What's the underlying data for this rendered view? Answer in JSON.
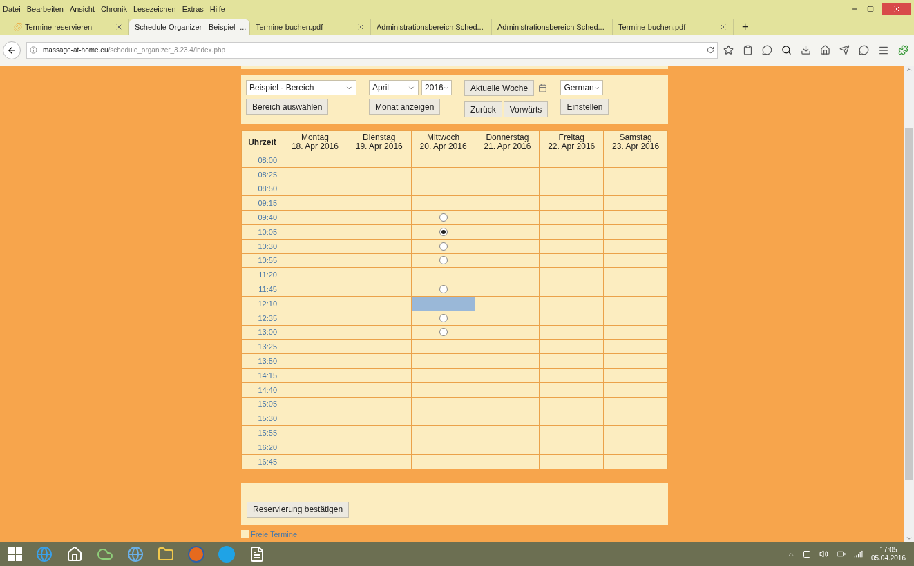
{
  "menu": [
    "Datei",
    "Bearbeiten",
    "Ansicht",
    "Chronik",
    "Lesezeichen",
    "Extras",
    "Hilfe"
  ],
  "tabs": [
    {
      "label": "Termine reservieren",
      "selected": false,
      "favicon": true
    },
    {
      "label": "Schedule Organizer - Beispiel -...",
      "selected": true,
      "favicon": false
    },
    {
      "label": "Termine-buchen.pdf",
      "selected": false,
      "favicon": false
    },
    {
      "label": "Administrationsbereich Sched...",
      "selected": false,
      "favicon": false
    },
    {
      "label": "Administrationsbereich Sched...",
      "selected": false,
      "favicon": false
    },
    {
      "label": "Termine-buchen.pdf",
      "selected": false,
      "favicon": false
    }
  ],
  "new_tab": "+",
  "address": {
    "domain": "massage-at-home.eu",
    "path": "/schedule_organizer_3.23.4/index.php"
  },
  "controls": {
    "area_select": "Beispiel - Bereich",
    "area_button": "Bereich auswählen",
    "month_select": "April",
    "year_select": "2016",
    "month_button": "Monat anzeigen",
    "current_week_button": "Aktuelle Woche",
    "back_button": "Zurück",
    "forward_button": "Vorwärts",
    "language_select": "German",
    "settings_button": "Einstellen"
  },
  "table": {
    "time_heading": "Uhrzeit",
    "days": [
      {
        "name": "Montag",
        "date": "18. Apr 2016"
      },
      {
        "name": "Dienstag",
        "date": "19. Apr 2016"
      },
      {
        "name": "Mittwoch",
        "date": "20. Apr 2016"
      },
      {
        "name": "Donnerstag",
        "date": "21. Apr 2016"
      },
      {
        "name": "Freitag",
        "date": "22. Apr 2016"
      },
      {
        "name": "Samstag",
        "date": "23. Apr 2016"
      }
    ],
    "rows": [
      {
        "time": "08:00",
        "cells": [
          {
            "kind": "empty"
          },
          {
            "kind": "empty"
          },
          {
            "kind": "empty"
          },
          {
            "kind": "empty"
          },
          {
            "kind": "empty"
          },
          {
            "kind": "empty"
          }
        ]
      },
      {
        "time": "08:25",
        "cells": [
          {
            "kind": "empty"
          },
          {
            "kind": "empty"
          },
          {
            "kind": "empty"
          },
          {
            "kind": "empty"
          },
          {
            "kind": "empty"
          },
          {
            "kind": "empty"
          }
        ]
      },
      {
        "time": "08:50",
        "cells": [
          {
            "kind": "empty"
          },
          {
            "kind": "empty"
          },
          {
            "kind": "empty"
          },
          {
            "kind": "empty"
          },
          {
            "kind": "empty"
          },
          {
            "kind": "empty"
          }
        ]
      },
      {
        "time": "09:15",
        "cells": [
          {
            "kind": "empty"
          },
          {
            "kind": "empty"
          },
          {
            "kind": "empty"
          },
          {
            "kind": "empty"
          },
          {
            "kind": "empty"
          },
          {
            "kind": "empty"
          }
        ]
      },
      {
        "time": "09:40",
        "cells": [
          {
            "kind": "empty"
          },
          {
            "kind": "empty"
          },
          {
            "kind": "radio",
            "selected": false
          },
          {
            "kind": "empty"
          },
          {
            "kind": "empty"
          },
          {
            "kind": "empty"
          }
        ]
      },
      {
        "time": "10:05",
        "cells": [
          {
            "kind": "empty"
          },
          {
            "kind": "empty"
          },
          {
            "kind": "radio",
            "selected": true
          },
          {
            "kind": "empty"
          },
          {
            "kind": "empty"
          },
          {
            "kind": "empty"
          }
        ]
      },
      {
        "time": "10:30",
        "cells": [
          {
            "kind": "empty"
          },
          {
            "kind": "empty"
          },
          {
            "kind": "radio",
            "selected": false
          },
          {
            "kind": "empty"
          },
          {
            "kind": "empty"
          },
          {
            "kind": "empty"
          }
        ]
      },
      {
        "time": "10:55",
        "cells": [
          {
            "kind": "empty"
          },
          {
            "kind": "empty"
          },
          {
            "kind": "radio",
            "selected": false
          },
          {
            "kind": "empty"
          },
          {
            "kind": "empty"
          },
          {
            "kind": "empty"
          }
        ]
      },
      {
        "time": "11:20",
        "cells": [
          {
            "kind": "empty"
          },
          {
            "kind": "empty"
          },
          {
            "kind": "empty"
          },
          {
            "kind": "empty"
          },
          {
            "kind": "empty"
          },
          {
            "kind": "empty"
          }
        ]
      },
      {
        "time": "11:45",
        "cells": [
          {
            "kind": "empty"
          },
          {
            "kind": "empty"
          },
          {
            "kind": "radio",
            "selected": false
          },
          {
            "kind": "empty"
          },
          {
            "kind": "empty"
          },
          {
            "kind": "empty"
          }
        ]
      },
      {
        "time": "12:10",
        "cells": [
          {
            "kind": "empty"
          },
          {
            "kind": "empty"
          },
          {
            "kind": "booked",
            "color": "#9ab8d8"
          },
          {
            "kind": "empty"
          },
          {
            "kind": "empty"
          },
          {
            "kind": "empty"
          }
        ]
      },
      {
        "time": "12:35",
        "cells": [
          {
            "kind": "empty"
          },
          {
            "kind": "empty"
          },
          {
            "kind": "radio",
            "selected": false
          },
          {
            "kind": "empty"
          },
          {
            "kind": "empty"
          },
          {
            "kind": "empty"
          }
        ]
      },
      {
        "time": "13:00",
        "cells": [
          {
            "kind": "empty"
          },
          {
            "kind": "empty"
          },
          {
            "kind": "radio",
            "selected": false
          },
          {
            "kind": "empty"
          },
          {
            "kind": "empty"
          },
          {
            "kind": "empty"
          }
        ]
      },
      {
        "time": "13:25",
        "cells": [
          {
            "kind": "empty"
          },
          {
            "kind": "empty"
          },
          {
            "kind": "empty"
          },
          {
            "kind": "empty"
          },
          {
            "kind": "empty"
          },
          {
            "kind": "empty"
          }
        ]
      },
      {
        "time": "13:50",
        "cells": [
          {
            "kind": "empty"
          },
          {
            "kind": "empty"
          },
          {
            "kind": "empty"
          },
          {
            "kind": "empty"
          },
          {
            "kind": "empty"
          },
          {
            "kind": "empty"
          }
        ]
      },
      {
        "time": "14:15",
        "cells": [
          {
            "kind": "empty"
          },
          {
            "kind": "empty"
          },
          {
            "kind": "empty"
          },
          {
            "kind": "empty"
          },
          {
            "kind": "empty"
          },
          {
            "kind": "empty"
          }
        ]
      },
      {
        "time": "14:40",
        "cells": [
          {
            "kind": "empty"
          },
          {
            "kind": "empty"
          },
          {
            "kind": "empty"
          },
          {
            "kind": "empty"
          },
          {
            "kind": "empty"
          },
          {
            "kind": "empty"
          }
        ]
      },
      {
        "time": "15:05",
        "cells": [
          {
            "kind": "empty"
          },
          {
            "kind": "empty"
          },
          {
            "kind": "empty"
          },
          {
            "kind": "empty"
          },
          {
            "kind": "empty"
          },
          {
            "kind": "empty"
          }
        ]
      },
      {
        "time": "15:30",
        "cells": [
          {
            "kind": "empty"
          },
          {
            "kind": "empty"
          },
          {
            "kind": "empty"
          },
          {
            "kind": "empty"
          },
          {
            "kind": "empty"
          },
          {
            "kind": "empty"
          }
        ]
      },
      {
        "time": "15:55",
        "cells": [
          {
            "kind": "empty"
          },
          {
            "kind": "empty"
          },
          {
            "kind": "empty"
          },
          {
            "kind": "empty"
          },
          {
            "kind": "empty"
          },
          {
            "kind": "empty"
          }
        ]
      },
      {
        "time": "16:20",
        "cells": [
          {
            "kind": "empty"
          },
          {
            "kind": "empty"
          },
          {
            "kind": "empty"
          },
          {
            "kind": "empty"
          },
          {
            "kind": "empty"
          },
          {
            "kind": "empty"
          }
        ]
      },
      {
        "time": "16:45",
        "cells": [
          {
            "kind": "empty"
          },
          {
            "kind": "empty"
          },
          {
            "kind": "empty"
          },
          {
            "kind": "empty"
          },
          {
            "kind": "empty"
          },
          {
            "kind": "empty"
          }
        ]
      }
    ]
  },
  "confirm_button": "Reservierung bestätigen",
  "legend": [
    {
      "label": "Freie Termine",
      "color": "#fcedc0"
    }
  ],
  "clock": {
    "time": "17:05",
    "date": "05.04.2016"
  }
}
